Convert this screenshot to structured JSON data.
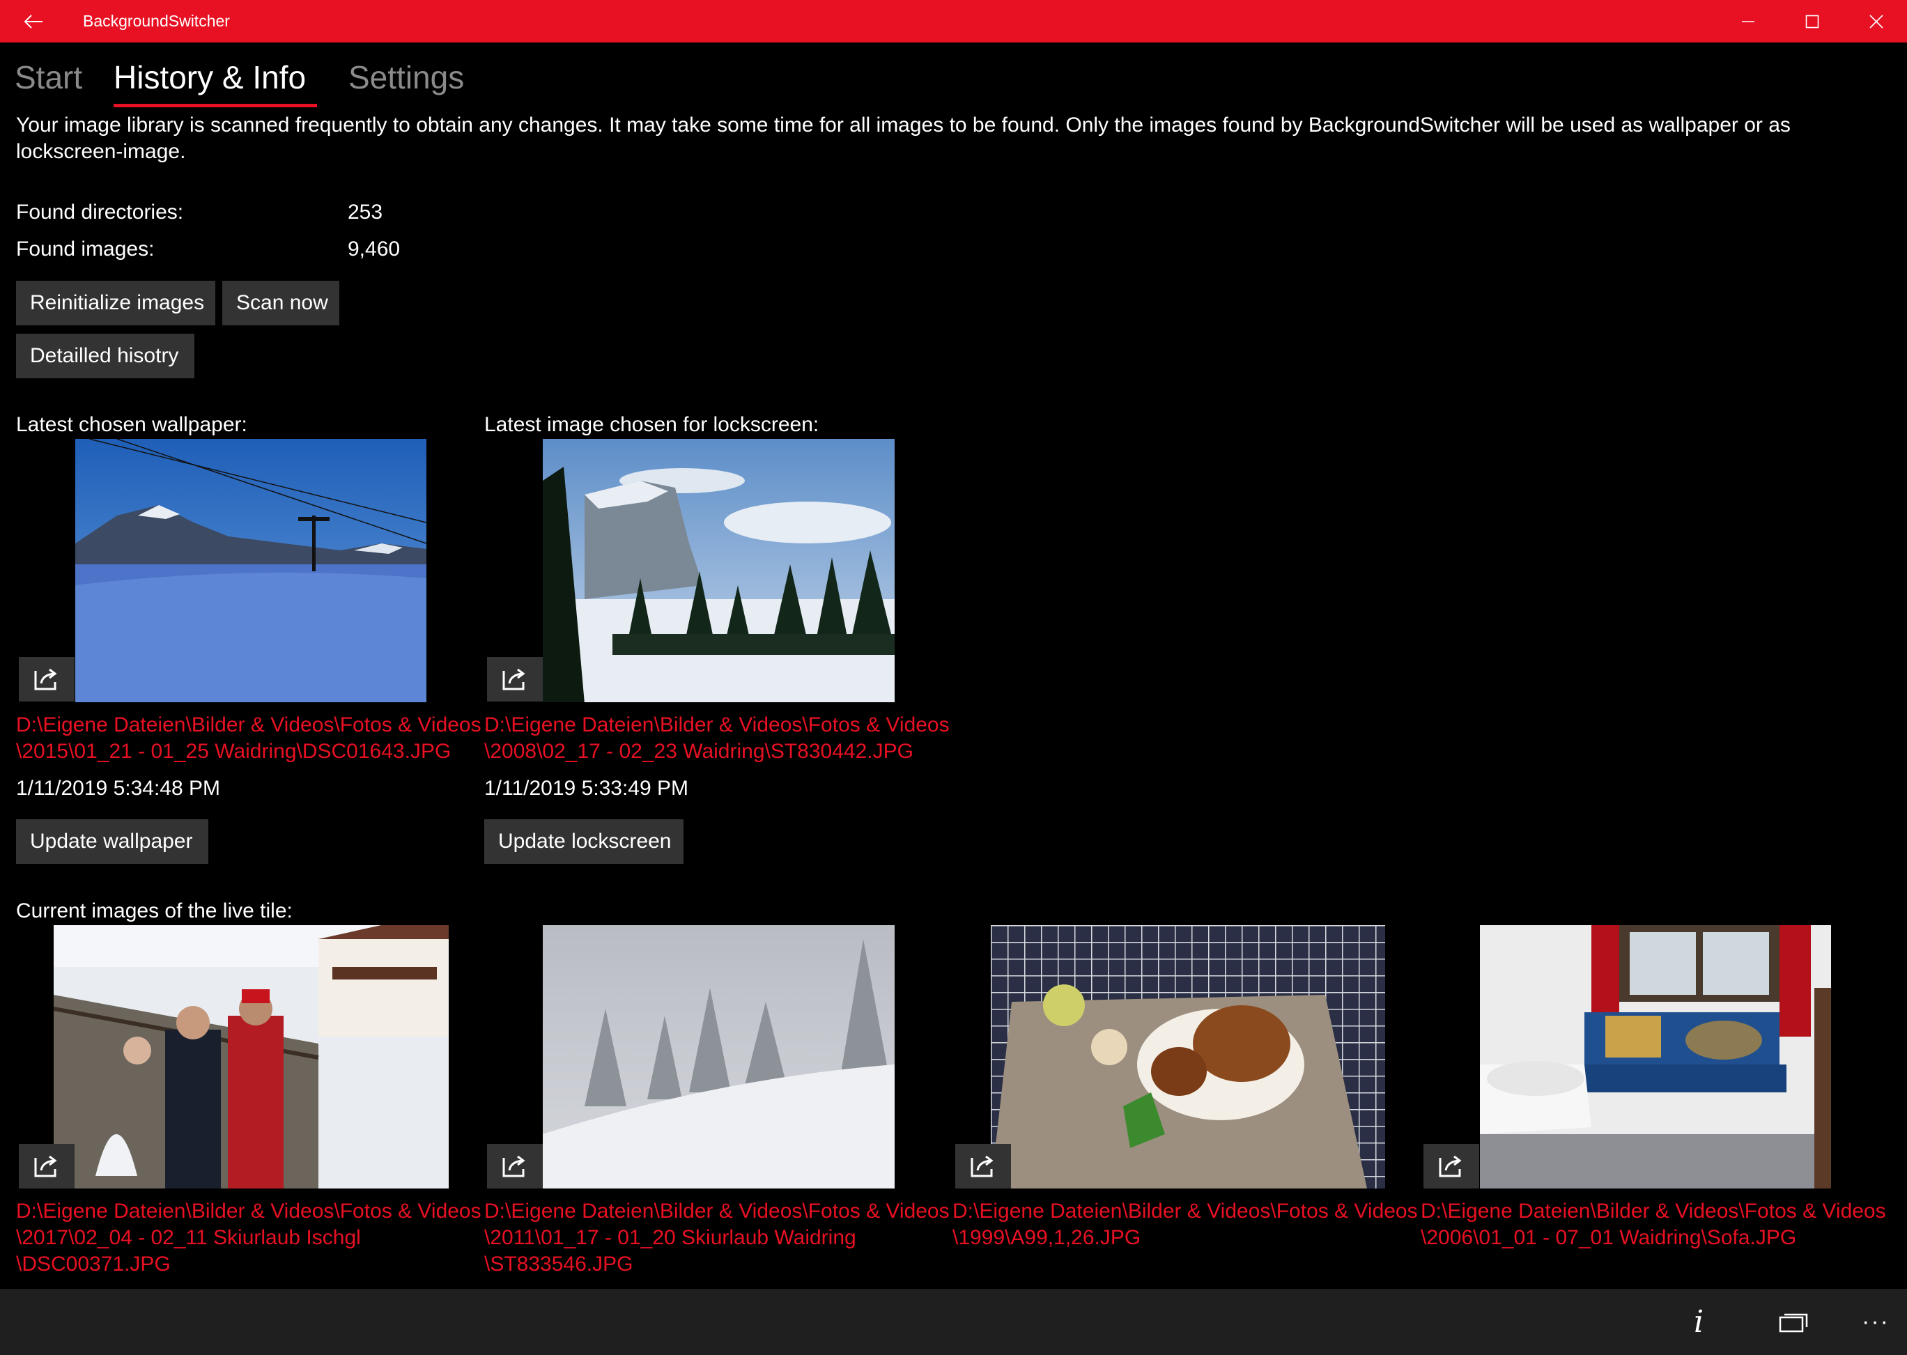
{
  "window": {
    "title": "BackgroundSwitcher",
    "titlebar_color": "#e81123"
  },
  "tabs": [
    {
      "label": "Start",
      "active": false
    },
    {
      "label": "History & Info",
      "active": true
    },
    {
      "label": "Settings",
      "active": false
    }
  ],
  "info": {
    "intro_line1": "Your image library is scanned frequently to obtain any changes. It may take some time for all images to be found. Only the images found by BackgroundSwitcher will be used as wallpaper or as",
    "intro_line2": "lockscreen-image.",
    "found_directories_label": "Found directories:",
    "found_directories_value": "253",
    "found_images_label": "Found images:",
    "found_images_value": "9,460"
  },
  "buttons": {
    "reinitialize": "Reinitialize images",
    "scan_now": "Scan now",
    "detailed_history": "Detailled hisotry",
    "update_wallpaper": "Update wallpaper",
    "update_lockscreen": "Update lockscreen"
  },
  "wallpaper": {
    "heading": "Latest chosen wallpaper:",
    "path_line1": "D:\\Eigene Dateien\\Bilder & Videos\\Fotos & Videos",
    "path_line2": "\\2015\\01_21 - 01_25 Waidring\\DSC01643.JPG",
    "timestamp": "1/11/2019 5:34:48 PM"
  },
  "lockscreen": {
    "heading": "Latest image chosen for lockscreen:",
    "path_line1": "D:\\Eigene Dateien\\Bilder & Videos\\Fotos & Videos",
    "path_line2": "\\2008\\02_17 - 02_23 Waidring\\ST830442.JPG",
    "timestamp": "1/11/2019 5:33:49 PM"
  },
  "live_tile": {
    "heading": "Current images of the live tile:",
    "images": [
      {
        "path_line1": "D:\\Eigene Dateien\\Bilder & Videos\\Fotos & Videos",
        "path_line2": "\\2017\\02_04 - 02_11 Skiurlaub Ischgl",
        "path_line3": "\\DSC00371.JPG"
      },
      {
        "path_line1": "D:\\Eigene Dateien\\Bilder & Videos\\Fotos & Videos",
        "path_line2": "\\2011\\01_17 - 01_20 Skiurlaub Waidring",
        "path_line3": "\\ST833546.JPG"
      },
      {
        "path_line1": "D:\\Eigene Dateien\\Bilder & Videos\\Fotos & Videos",
        "path_line2": "\\1999\\A99,1,26.JPG"
      },
      {
        "path_line1": "D:\\Eigene Dateien\\Bilder & Videos\\Fotos & Videos",
        "path_line2": "\\2006\\01_01 - 07_01 Waidring\\Sofa.JPG"
      }
    ]
  },
  "appbar": {
    "info_glyph": "i",
    "more_glyph": "···"
  }
}
